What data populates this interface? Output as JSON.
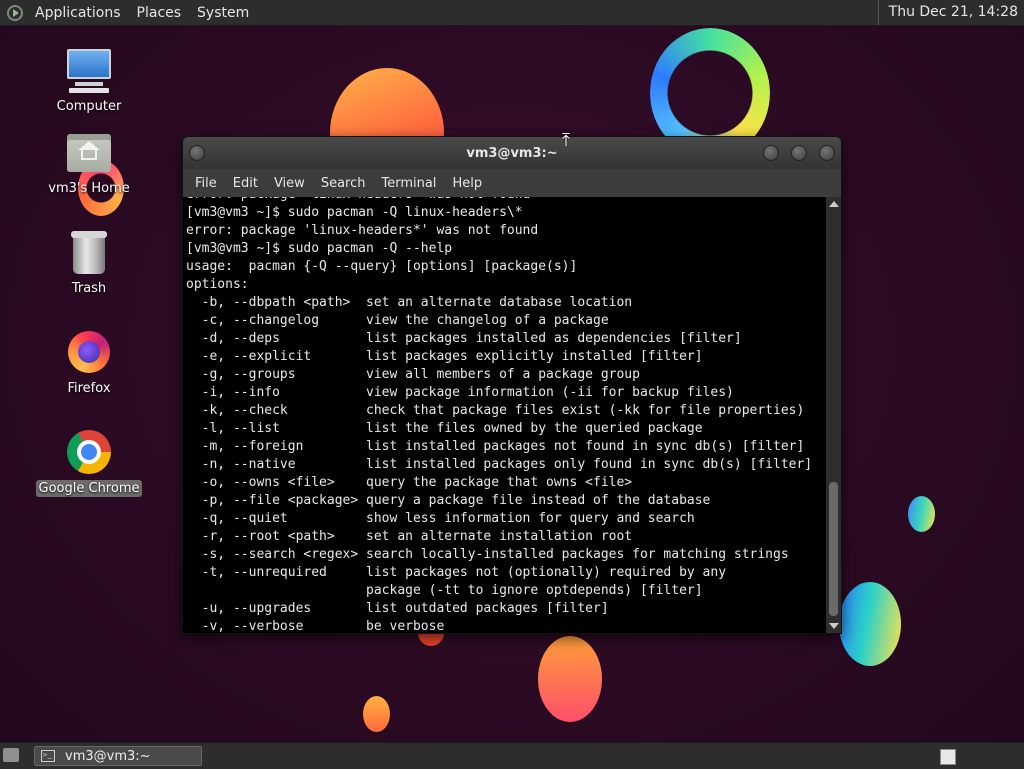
{
  "top_panel": {
    "menus": [
      "Applications",
      "Places",
      "System"
    ],
    "clock": "Thu Dec 21, 14:28"
  },
  "desktop_icons": [
    {
      "label": "Computer",
      "icon": "computer-icon"
    },
    {
      "label": "vm3's Home",
      "icon": "home-folder-icon"
    },
    {
      "label": "Trash",
      "icon": "trash-icon"
    },
    {
      "label": "Firefox",
      "icon": "firefox-icon"
    },
    {
      "label": "Google Chrome",
      "icon": "chrome-icon",
      "selected": true
    }
  ],
  "terminal": {
    "title": "vm3@vm3:~",
    "menu": [
      "File",
      "Edit",
      "View",
      "Search",
      "Terminal",
      "Help"
    ],
    "lines": [
      "error: package 'linux-headers' was not found",
      "[vm3@vm3 ~]$ sudo pacman -Q linux-headers\\*",
      "error: package 'linux-headers*' was not found",
      "[vm3@vm3 ~]$ sudo pacman -Q --help",
      "usage:  pacman {-Q --query} [options] [package(s)]",
      "options:",
      "  -b, --dbpath <path>  set an alternate database location",
      "  -c, --changelog      view the changelog of a package",
      "  -d, --deps           list packages installed as dependencies [filter]",
      "  -e, --explicit       list packages explicitly installed [filter]",
      "  -g, --groups         view all members of a package group",
      "  -i, --info           view package information (-ii for backup files)",
      "  -k, --check          check that package files exist (-kk for file properties)",
      "  -l, --list           list the files owned by the queried package",
      "  -m, --foreign        list installed packages not found in sync db(s) [filter]",
      "  -n, --native         list installed packages only found in sync db(s) [filter]",
      "  -o, --owns <file>    query the package that owns <file>",
      "  -p, --file <package> query a package file instead of the database",
      "  -q, --quiet          show less information for query and search",
      "  -r, --root <path>    set an alternate installation root",
      "  -s, --search <regex> search locally-installed packages for matching strings",
      "  -t, --unrequired     list packages not (optionally) required by any",
      "                       package (-tt to ignore optdepends) [filter]",
      "  -u, --upgrades       list outdated packages [filter]",
      "  -v, --verbose        be verbose"
    ]
  },
  "taskbar": {
    "task_label": "vm3@vm3:~"
  }
}
